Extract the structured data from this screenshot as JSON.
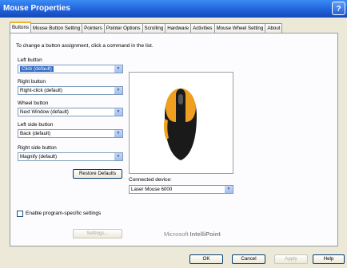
{
  "window": {
    "title": "Mouse Properties",
    "help_label": "?"
  },
  "tabs": [
    "Buttons",
    "Mouse Button Setting",
    "Pointers",
    "Pointer Options",
    "Scrolling",
    "Hardware",
    "Activities",
    "Mouse Wheel Setting",
    "About"
  ],
  "instruction": "To change a button assignment, click a command in the list.",
  "buttons": [
    {
      "label": "Left button",
      "value": "Click (default)",
      "selected": true
    },
    {
      "label": "Right button",
      "value": "Right-click (default)"
    },
    {
      "label": "Wheel button",
      "value": "Next Window (default)"
    },
    {
      "label": "Left side button",
      "value": "Back (default)"
    },
    {
      "label": "Right side button",
      "value": "Magnify (default)"
    }
  ],
  "restore_label": "Restore Defaults",
  "connected_label": "Connected device:",
  "connected_value": "Laser Mouse 6000",
  "program_checkbox_label": "Enable program-specific settings",
  "settings_button": "Settings...",
  "brand": {
    "prefix": "Microsoft",
    "product": "IntelliPoint"
  },
  "footer": {
    "ok": "OK",
    "cancel": "Cancel",
    "apply": "Apply",
    "help": "Help"
  },
  "colors": {
    "accent": "#f0a020",
    "selection": "#316ac5",
    "title_bar": "#1f5fd8"
  }
}
